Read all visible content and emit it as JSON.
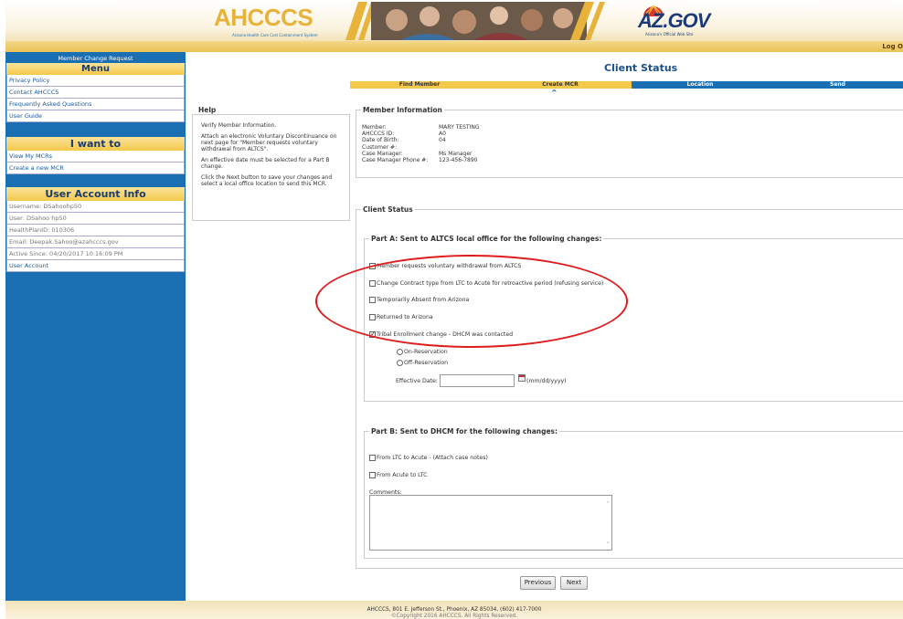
{
  "header": {
    "ahcccs_logo": "AHCCCS",
    "ahcccs_tagline": "Arizona Health Care Cost Containment System",
    "az_logo": "AZ.GOV",
    "az_tagline": "Arizona's Official Web Site",
    "logout": "Log O"
  },
  "sidebar": {
    "title": "Member Change Request",
    "menu_heading": "Menu",
    "menu_items": [
      "Privacy Policy",
      "Contact AHCCCS",
      "Frequently Asked Questions",
      "User Guide"
    ],
    "iwant_heading": "I want to",
    "iwant_items": [
      "View My MCRs",
      "Create a new MCR"
    ],
    "account_heading": "User Account Info",
    "account_items": [
      "Username: DSahoohp50",
      "User: DSahoo hp50",
      "HealthPlanID: 010306",
      "Email: Deepak.Sahoo@azahcccs.gov",
      "Active Since: 04/20/2017 10:16:09 PM"
    ],
    "account_link": "User Account"
  },
  "page": {
    "title": "Client Status",
    "steps": [
      "Find Member",
      "Create MCR",
      "Location",
      "Send"
    ],
    "current_step_marker": "^"
  },
  "help": {
    "title": "Help",
    "paragraphs": [
      "Verify Member Information.",
      "Attach an electronic Voluntary Discontinuance on next page for \"Member requests voluntary withdrawal from ALTCS\".",
      "An effective date must be selected for a Part B change.",
      "Click the Next button to save your changes and select a local office location to send this MCR."
    ]
  },
  "member_info": {
    "legend": "Member Information",
    "rows": [
      {
        "label": "Member:",
        "value": "MARY TESTING"
      },
      {
        "label": "AHCCCS ID:",
        "value": "A0"
      },
      {
        "label": "Date of Birth:",
        "value": "04"
      },
      {
        "label": "Customer #:",
        "value": ""
      },
      {
        "label": "Case Manager:",
        "value": "Ms Manager"
      },
      {
        "label": "Case Manager Phone #:",
        "value": "123-456-7890"
      }
    ]
  },
  "client_status": {
    "legend": "Client Status",
    "part_a": {
      "legend": "Part A: Sent to ALTCS local office for the following changes:",
      "options": [
        {
          "label": "Member requests voluntary withdrawal from ALTCS",
          "checked": false
        },
        {
          "label": "Change Contract type from LTC to Acute for retroactive period (refusing service)",
          "checked": false
        },
        {
          "label": "Temporarily Absent from Arizona",
          "checked": false
        },
        {
          "label": "Returned to Arizona",
          "checked": false
        },
        {
          "label": "Tribal Enrollment change - DHCM was contacted",
          "checked": true
        }
      ],
      "radios": [
        "On-Reservation",
        "Off-Reservation"
      ],
      "effective_date_label": "Effective Date:",
      "effective_date_value": "",
      "date_hint": "(mm/dd/yyyy)"
    },
    "part_b": {
      "legend": "Part B: Sent to DHCM for the following changes:",
      "options": [
        {
          "label": "From LTC to Acute - (Attach case notes)",
          "checked": false
        },
        {
          "label": "From Acute to LTC",
          "checked": false
        }
      ],
      "comments_label": "Comments:",
      "comments_value": ""
    }
  },
  "buttons": {
    "previous": "Previous",
    "next": "Next"
  },
  "footer": {
    "line1": "AHCCCS, 801 E. Jefferson St., Phoenix, AZ 85034, (602) 417-7000",
    "line2": "©Copyright 2016 AHCCCS. All Rights Reserved."
  },
  "colors": {
    "sidebar_blue": "#1a6fb3",
    "gold": "#f3c84b",
    "annotation_red": "#e01c1c"
  }
}
